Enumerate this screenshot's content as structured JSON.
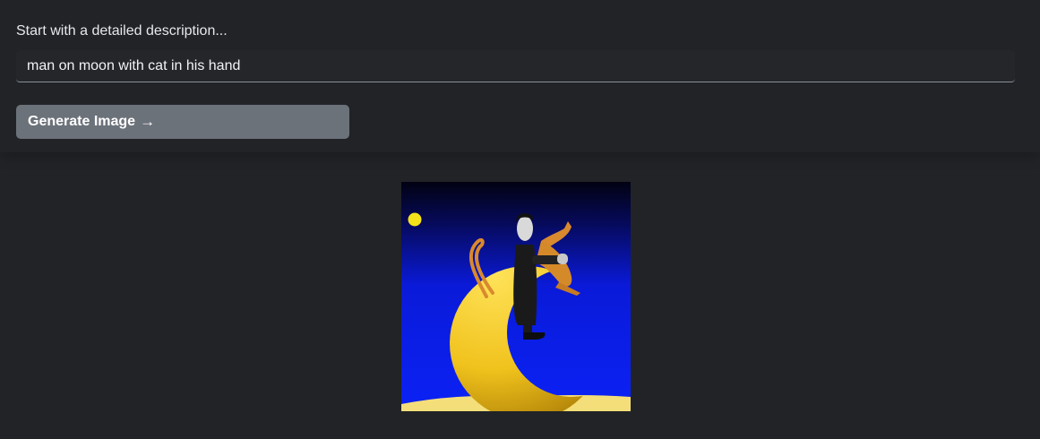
{
  "form": {
    "label": "Start with a detailed description...",
    "prompt_value": "man on moon with cat in his hand",
    "generate_label": "Generate Image",
    "generate_arrow": "→"
  },
  "result": {
    "image_icon": "generated-image",
    "colors": {
      "sky_top": "#04041a",
      "sky_bottom": "#0a1cf0",
      "moon": "#f2c71c",
      "cat": "#d9892e",
      "coat": "#1c1c1c"
    }
  }
}
